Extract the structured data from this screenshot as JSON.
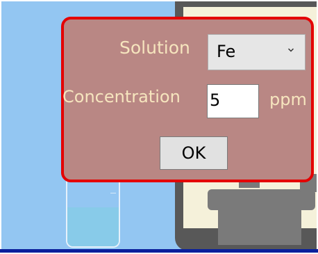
{
  "dialog": {
    "solution_label": "Solution",
    "solution_value": "Fe",
    "concentration_label": "Concentration",
    "concentration_value": "5",
    "unit_label": "ppm",
    "ok_label": "OK"
  },
  "colors": {
    "background": "#93c6f2",
    "dialog_fill": "#b98784",
    "dialog_border": "#e40000",
    "label_text": "#f6e5be",
    "instrument": "#585858"
  },
  "icons": {
    "dropdown": "chevron-down-icon"
  }
}
